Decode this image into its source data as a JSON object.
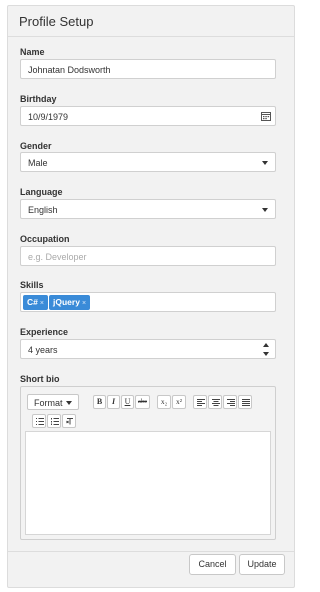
{
  "panel": {
    "title": "Profile Setup"
  },
  "form": {
    "name": {
      "label": "Name",
      "value": "Johnatan Dodsworth"
    },
    "birthday": {
      "label": "Birthday",
      "value": "10/9/1979",
      "icon": "calendar-icon"
    },
    "gender": {
      "label": "Gender",
      "value": "Male"
    },
    "language": {
      "label": "Language",
      "value": "English"
    },
    "occupation": {
      "label": "Occupation",
      "placeholder": "e.g. Developer"
    },
    "skills": {
      "label": "Skills",
      "tags": [
        "C#",
        "jQuery"
      ],
      "remove_glyph": "×"
    },
    "experience": {
      "label": "Experience",
      "value": "4 years"
    },
    "bio": {
      "label": "Short bio",
      "format_label": "Format",
      "bold": "B",
      "italic": "I",
      "underline": "U",
      "strike": "abc",
      "subscript": "x₂",
      "superscript": "x²",
      "text": ""
    }
  },
  "footer": {
    "cancel_label": "Cancel",
    "update_label": "Update"
  },
  "colors": {
    "tag": "#3a8bd8",
    "panel_bg": "#f2f2f2",
    "border": "#d0d0d0"
  }
}
